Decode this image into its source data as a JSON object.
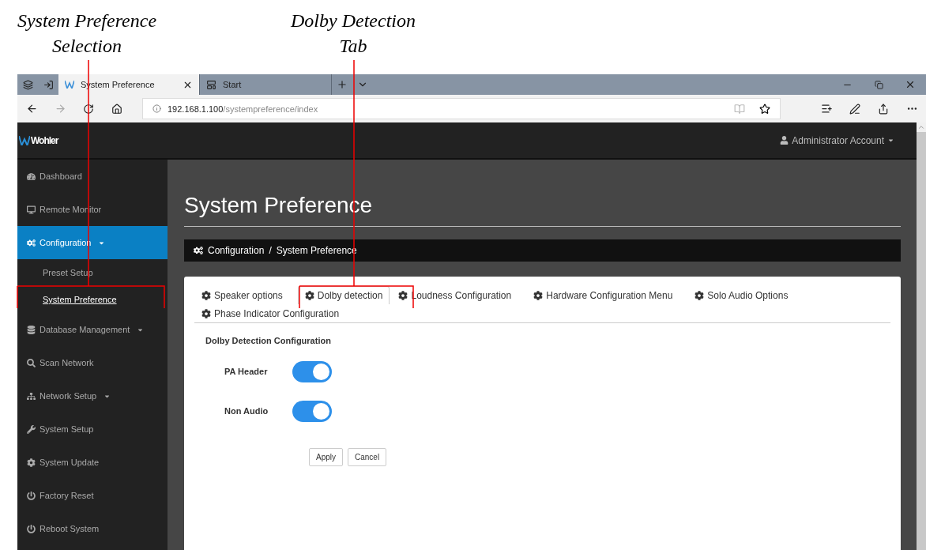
{
  "annotations": [
    {
      "text": "System Preference Selection"
    },
    {
      "text": "Dolby Detection Tab"
    }
  ],
  "browser": {
    "tabs": [
      {
        "title": "System Preference",
        "selected": true,
        "kind": "site"
      },
      {
        "title": "Start",
        "selected": false,
        "kind": "start"
      }
    ],
    "address": {
      "host": "192.168.1.100",
      "path": "/systempreference/index"
    }
  },
  "app": {
    "logo": "Wohler",
    "account": "Administrator Account"
  },
  "sidebar": {
    "items": [
      {
        "label": "Dashboard",
        "kind": "dashboard",
        "selected": false,
        "caret": false
      },
      {
        "label": "Remote Monitor",
        "kind": "monitor",
        "selected": false,
        "caret": false
      },
      {
        "label": "Configuration",
        "kind": "config",
        "selected": true,
        "caret": true,
        "children": [
          {
            "label": "Preset Setup",
            "selected": false
          },
          {
            "label": "System Preference",
            "selected": true
          }
        ]
      },
      {
        "label": "Database Management",
        "kind": "database",
        "selected": false,
        "caret": true
      },
      {
        "label": "Scan Network",
        "kind": "search",
        "selected": false,
        "caret": false
      },
      {
        "label": "Network Setup",
        "kind": "network",
        "selected": false,
        "caret": true
      },
      {
        "label": "System Setup",
        "kind": "wrench",
        "selected": false,
        "caret": false
      },
      {
        "label": "System Update",
        "kind": "gear",
        "selected": false,
        "caret": false
      },
      {
        "label": "Factory Reset",
        "kind": "power",
        "selected": false,
        "caret": false
      },
      {
        "label": "Reboot System",
        "kind": "power",
        "selected": false,
        "caret": false
      }
    ]
  },
  "page": {
    "title": "System Preference",
    "breadcrumb": [
      "Configuration",
      "/",
      "System Preference"
    ],
    "tabs": [
      {
        "label": "Speaker options",
        "selected": false
      },
      {
        "label": "Dolby detection",
        "selected": true
      },
      {
        "label": "Loudness Configuration",
        "selected": false
      },
      {
        "label": "Hardware Configuration Menu",
        "selected": false
      },
      {
        "label": "Solo Audio Options",
        "selected": false
      },
      {
        "label": "Phase Indicator Configuration",
        "selected": false
      }
    ],
    "section": "Dolby Detection Configuration",
    "toggles": [
      {
        "label": "PA Header",
        "on": true
      },
      {
        "label": "Non Audio",
        "on": true
      }
    ],
    "buttons": [
      "Apply",
      "Cancel"
    ]
  }
}
